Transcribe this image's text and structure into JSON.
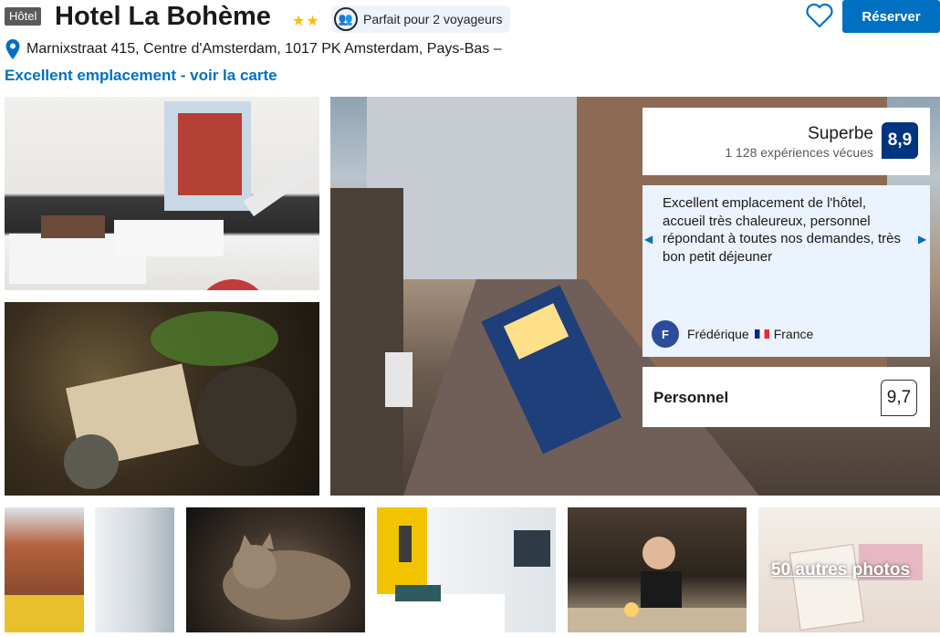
{
  "header": {
    "type_badge": "Hôtel",
    "title": "Hotel La Bohème",
    "stars": "★★",
    "stars_color": "#febb02",
    "traveler_pill": "Parfait pour 2 voyageurs",
    "reserve_label": "Réserver",
    "brand_blue": "#0071c2"
  },
  "location": {
    "address": "Marnixstraat 415, Centre d'Amsterdam, 1017 PK Amsterdam, Pays-Bas –",
    "map_link": "Excellent emplacement - voir la carte"
  },
  "gallery": {
    "more_photos": "50 autres photos"
  },
  "review_panel": {
    "score_word": "Superbe",
    "score_count": "1 128 expériences vécues",
    "score": "8,9",
    "review_text": "Excellent emplacement de l'hôtel, accueil très chaleureux, personnel répondant à toutes nos demandes, très bon petit déjeuner",
    "reviewer_initial": "F",
    "reviewer_name": "Frédérique",
    "reviewer_country": "France",
    "category_label": "Personnel",
    "category_score": "9,7",
    "score_box_color": "#003580"
  }
}
